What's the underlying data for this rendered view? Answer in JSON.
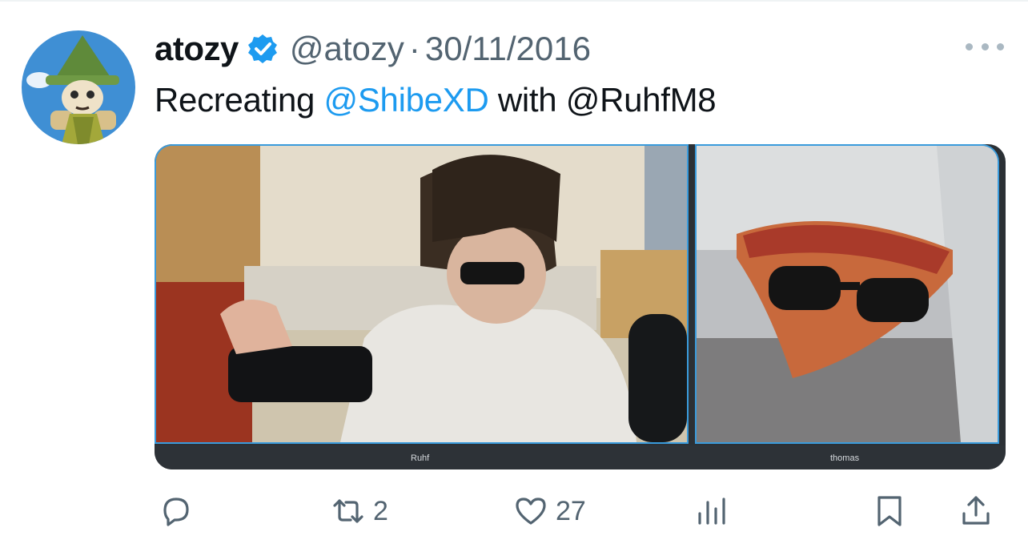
{
  "tweet": {
    "author_name": "atozy",
    "handle": "@atozy",
    "separator": "·",
    "date": "30/11/2016",
    "text_parts": [
      "Recreating ",
      "@ShibeXD",
      " with @RuhfM8"
    ]
  },
  "media": {
    "left_caption": "Ruhf",
    "right_caption": "thomas"
  },
  "actions": {
    "retweets": "2",
    "likes": "27"
  },
  "colors": {
    "accent": "#1d9bf0",
    "text": "#0f1419",
    "secondary": "#536471",
    "frame_border": "#3a9bdc"
  }
}
